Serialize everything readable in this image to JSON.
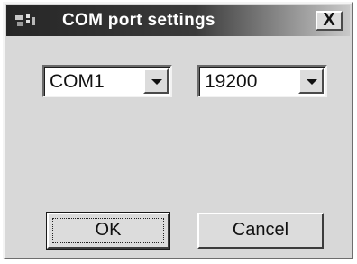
{
  "window": {
    "title": "COM port settings",
    "close_label": "X"
  },
  "port": {
    "value": "COM1"
  },
  "baud": {
    "value": "19200"
  },
  "buttons": {
    "ok_label": "OK",
    "cancel_label": "Cancel"
  }
}
